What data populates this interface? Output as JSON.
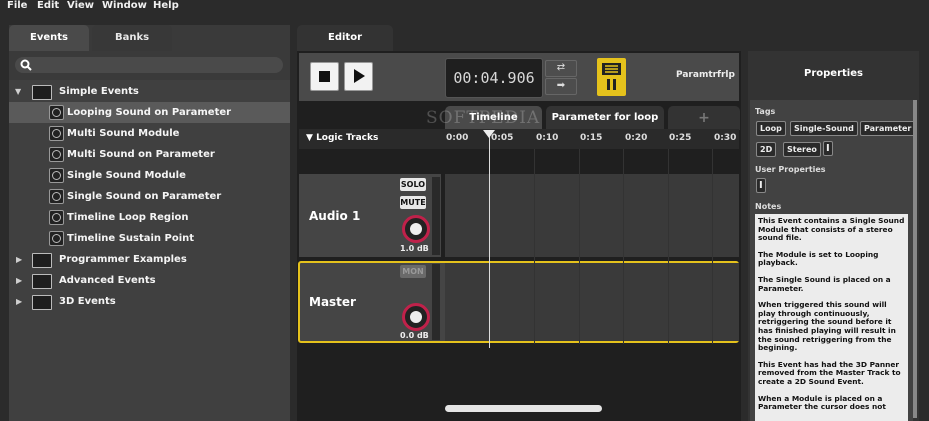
{
  "menu": [
    "File",
    "Edit",
    "View",
    "Window",
    "Help"
  ],
  "left_tabs": {
    "events": "Events",
    "banks": "Banks"
  },
  "tree": {
    "items": [
      {
        "label": "Simple Events",
        "type": "folder-open",
        "level": 0
      },
      {
        "label": "Looping Sound on Parameter",
        "type": "event",
        "level": 1,
        "selected": true
      },
      {
        "label": "Multi Sound Module",
        "type": "event",
        "level": 1
      },
      {
        "label": "Multi Sound on Parameter",
        "type": "event",
        "level": 1
      },
      {
        "label": "Single Sound Module",
        "type": "event",
        "level": 1
      },
      {
        "label": "Single Sound on Parameter",
        "type": "event",
        "level": 1
      },
      {
        "label": "Timeline Loop Region",
        "type": "event",
        "level": 1
      },
      {
        "label": "Timeline Sustain Point",
        "type": "event",
        "level": 1
      },
      {
        "label": "Programmer Examples",
        "type": "folder",
        "level": 0
      },
      {
        "label": "Advanced Events",
        "type": "folder",
        "level": 0
      },
      {
        "label": "3D Events",
        "type": "folder",
        "level": 0
      }
    ]
  },
  "editor": {
    "tab_label": "Editor",
    "timecode": "00:04.906",
    "param_label": "Paramtrfrlp",
    "subtabs": {
      "timeline": "Timeline",
      "parameter": "Parameter for loop",
      "add": "+"
    },
    "logic_tracks_label": "Logic Tracks",
    "ruler_ticks": [
      "0:00",
      "0:05",
      "0:10",
      "0:15",
      "0:20",
      "0:25",
      "0:30"
    ],
    "tracks": [
      {
        "name": "Audio 1",
        "solo": "SOLO",
        "mute": "MUTE",
        "volume": "1.0 dB"
      },
      {
        "name": "Master",
        "mon": "MON",
        "volume": "0.0 dB"
      }
    ],
    "watermark": "SOFTPEDIA"
  },
  "properties": {
    "title": "Properties",
    "tags_label": "Tags",
    "tags": [
      "Loop",
      "Single-Sound",
      "Parameter",
      "2D",
      "Stereo"
    ],
    "user_properties_label": "User Properties",
    "notes_label": "Notes",
    "notes": [
      "This Event contains a Single Sound Module that consists of a stereo sound file.",
      "The Module is set to Looping playback.",
      "The Single Sound is placed on a Parameter.",
      "When triggered this sound will play through continuously, retriggering the sound before it has finished playing will result in the sound retriggering from the begining.",
      "This Event has had the 3D Panner removed from the Master Track to create a 2D Sound Event.",
      "When a Module is placed on a Parameter the cursor does not"
    ]
  },
  "colors": {
    "accent": "#e5c21c",
    "knob": "#c0214a"
  }
}
